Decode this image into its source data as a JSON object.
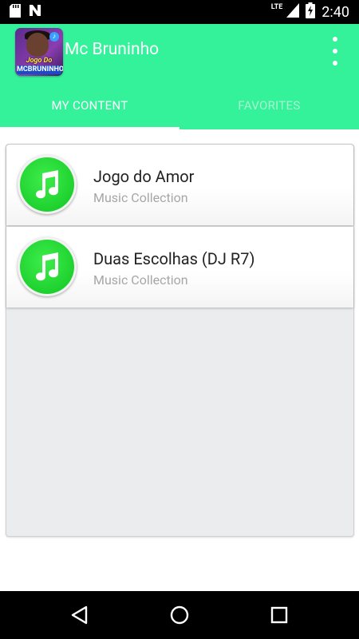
{
  "status_bar": {
    "time": "2:40",
    "network": "LTE",
    "icons": [
      "sd-card-icon",
      "notification-n-icon",
      "signal-icon",
      "battery-charging-icon"
    ]
  },
  "app_bar": {
    "title": "Mc Bruninho",
    "app_icon": {
      "line1": "Jogo Do Amor",
      "line2": "MCBRUNINHO"
    },
    "background": "#33f29a",
    "overflow_icon": "more-vert-icon"
  },
  "tabs": [
    {
      "label": "MY CONTENT",
      "active": true
    },
    {
      "label": "FAVORITES",
      "active": false
    }
  ],
  "list": [
    {
      "title": "Jogo do Amor",
      "subtitle": "Music Collection",
      "icon": "music-note-icon"
    },
    {
      "title": "Duas Escolhas (DJ R7)",
      "subtitle": "Music Collection",
      "icon": "music-note-icon"
    }
  ],
  "nav_bar": {
    "buttons": [
      "back-icon",
      "home-icon",
      "recents-icon"
    ]
  },
  "colors": {
    "accent": "#33f29a",
    "music_icon": "#27d838",
    "card_background": "#ebeced"
  }
}
